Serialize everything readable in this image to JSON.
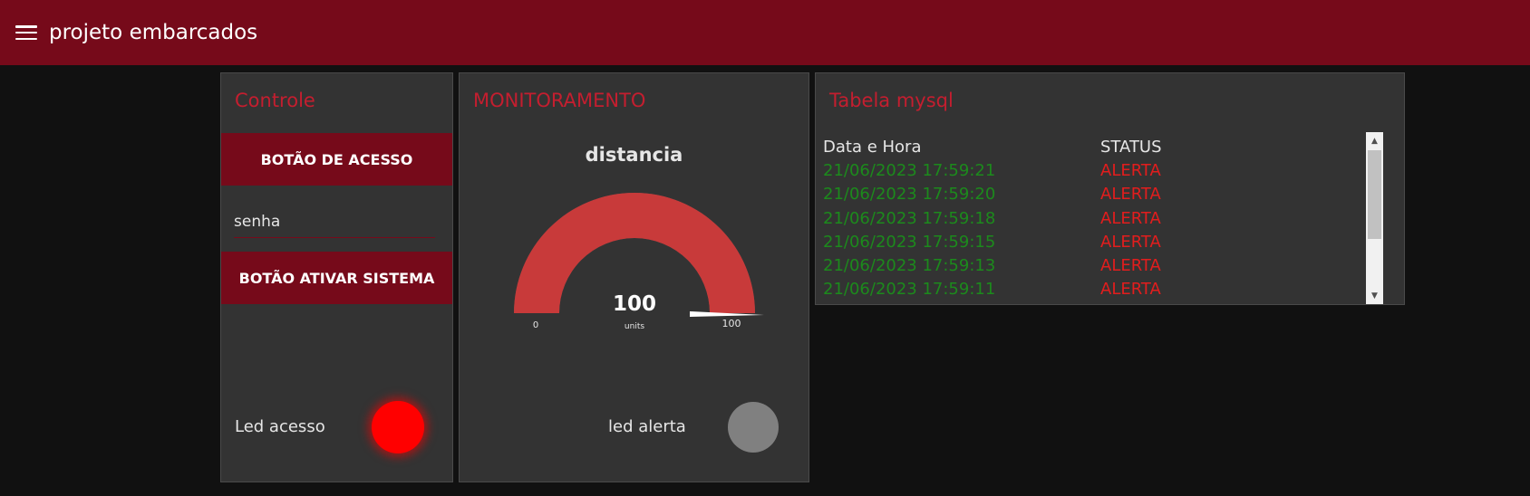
{
  "header": {
    "title": "projeto embarcados",
    "menu_icon": "hamburger-menu-icon"
  },
  "controle": {
    "title": "Controle",
    "access_button": "BOTÃO DE ACESSO",
    "password_placeholder": "senha",
    "activate_button": "BOTÃO ATIVAR SISTEMA",
    "led_label": "Led acesso",
    "led_color": "#ff0000"
  },
  "monitoramento": {
    "title": "MONITORAMENTO",
    "gauge": {
      "title": "distancia",
      "value": "100",
      "units": "units",
      "min": "0",
      "max": "100",
      "fill_fraction": 1.0,
      "color": "#C83A3A"
    },
    "led_label": "led alerta",
    "led_color": "#808080"
  },
  "tabela": {
    "title": "Tabela mysql",
    "columns": [
      "Data e Hora",
      "STATUS"
    ],
    "rows": [
      [
        "21/06/2023 17:59:21",
        "ALERTA"
      ],
      [
        "21/06/2023 17:59:20",
        "ALERTA"
      ],
      [
        "21/06/2023 17:59:18",
        "ALERTA"
      ],
      [
        "21/06/2023 17:59:15",
        "ALERTA"
      ],
      [
        "21/06/2023 17:59:13",
        "ALERTA"
      ],
      [
        "21/06/2023 17:59:11",
        "ALERTA"
      ]
    ]
  },
  "colors": {
    "accent": "#760A1A",
    "title_red": "#C41E2F",
    "card_bg": "#333333",
    "page_bg": "#111111"
  }
}
